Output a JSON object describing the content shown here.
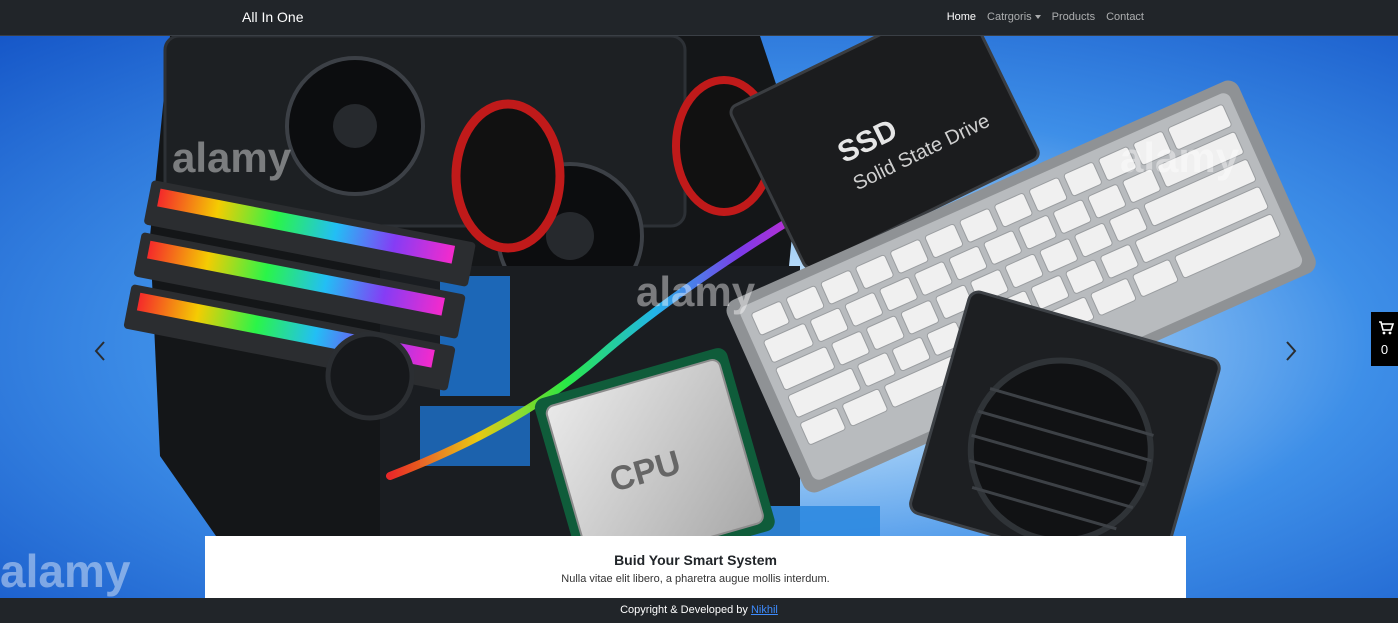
{
  "navbar": {
    "brand": "All In One",
    "items": [
      {
        "label": "Home",
        "active": true
      },
      {
        "label": "Catrgoris",
        "dropdown": true
      },
      {
        "label": "Products"
      },
      {
        "label": "Contact"
      }
    ]
  },
  "hero": {
    "watermark": "alamy",
    "caption_title": "Buid Your Smart System",
    "caption_text": "Nulla vitae elit libero, a pharetra augue mollis interdum.",
    "ssd_label": "SSD",
    "ssd_sublabel": "Solid State Drive",
    "cpu_label": "CPU",
    "prev_icon": "chevron-left-icon",
    "next_icon": "chevron-right-icon"
  },
  "cart": {
    "icon": "cart-icon",
    "count": "0"
  },
  "footer": {
    "text": "Copyright & Developed by",
    "link": "Nikhil"
  },
  "colors": {
    "navbar_bg": "#212529",
    "link": "#3d8bfd",
    "hero_blue": "#1657c8"
  }
}
